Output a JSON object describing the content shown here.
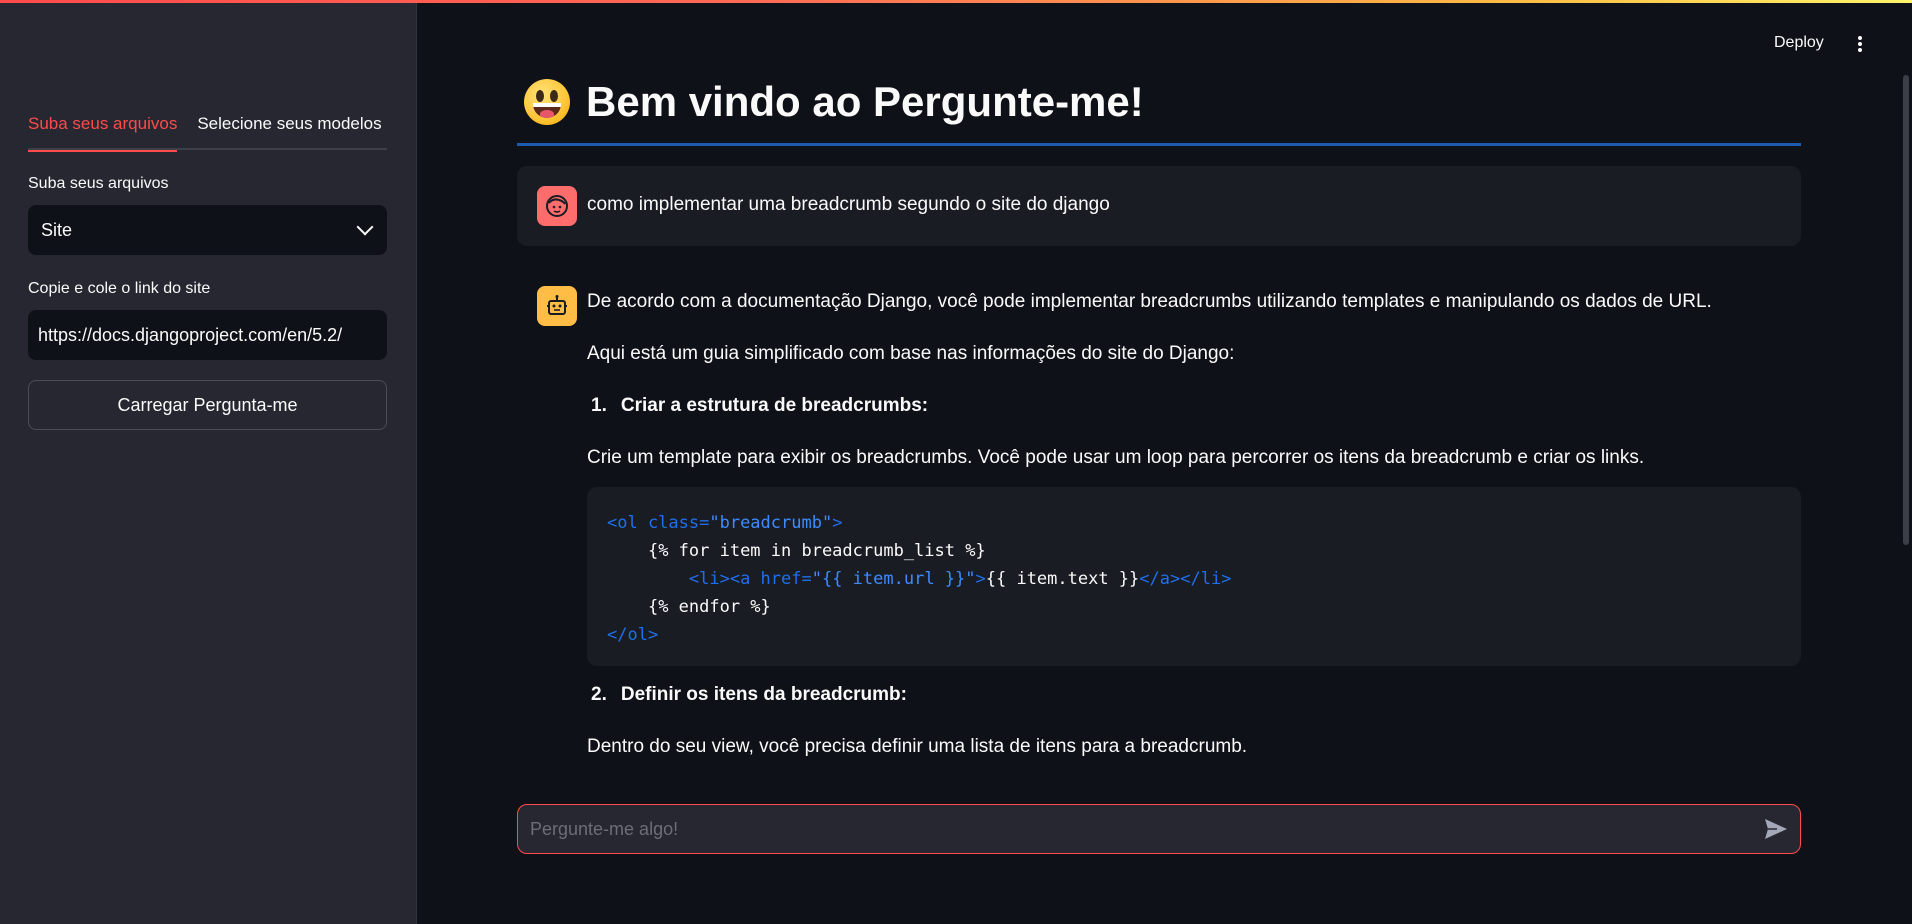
{
  "sidebar": {
    "tabs": [
      {
        "label": "Suba seus arquivos",
        "active": true
      },
      {
        "label": "Selecione seus modelos",
        "active": false
      }
    ],
    "upload_label": "Suba seus arquivos",
    "source_select": {
      "selected": "Site"
    },
    "link_label": "Copie e cole o link do site",
    "link_input": {
      "value": "https://docs.djangoproject.com/en/5.2/"
    },
    "load_button": "Carregar Pergunta-me"
  },
  "header": {
    "deploy_label": "Deploy",
    "menu_icon": "kebab-menu-icon"
  },
  "main": {
    "title": "Bem vindo ao Pergunte-me!",
    "title_icon": "grinning-face-emoji",
    "user_message": "como implementar uma breadcrumb segundo o site do django",
    "bot_message": {
      "intro": "De acordo com a documentação Django, você pode implementar breadcrumbs utilizando templates e manipulando os dados de URL.",
      "guide": "Aqui está um guia simplificado com base nas informações do site do Django:",
      "step1_number": "1.",
      "step1_title": "Criar a estrutura de breadcrumbs:",
      "step1_text": "Crie um template para exibir os breadcrumbs. Você pode usar um loop para percorrer os itens da breadcrumb e criar os links.",
      "code_lines": [
        "<ol class=\"breadcrumb\">",
        "    {% for item in breadcrumb_list %}",
        "        <li><a href=\"{{ item.url }}\">{{ item.text }}</a></li>",
        "    {% endfor %}",
        "</ol>"
      ],
      "step2_number": "2.",
      "step2_title": "Definir os itens da breadcrumb:",
      "step2_text": "Dentro do seu view, você precisa definir uma lista de itens para a breadcrumb."
    },
    "chat_input": {
      "placeholder": "Pergunte-me algo!"
    }
  },
  "colors": {
    "accent": "#ff4b4b",
    "background": "#0e1117",
    "sidebar": "#262730",
    "divider": "#1c5bb0",
    "user_avatar": "#ff6c6c",
    "bot_avatar": "#ffbd45"
  }
}
